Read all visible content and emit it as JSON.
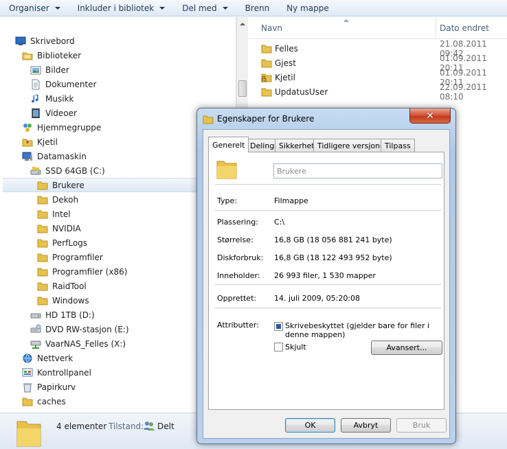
{
  "toolbar": {
    "organise": "Organiser",
    "include": "Inkluder i bibliotek",
    "share": "Del med",
    "burn": "Brenn",
    "new_folder": "Ny mappe"
  },
  "nav": {
    "items": [
      {
        "label": "Skrivebord"
      },
      {
        "label": "Biblioteker"
      },
      {
        "label": "Bilder"
      },
      {
        "label": "Dokumenter"
      },
      {
        "label": "Musikk"
      },
      {
        "label": "Videoer"
      },
      {
        "label": "Hjemmegruppe"
      },
      {
        "label": "Kjetil"
      },
      {
        "label": "Datamaskin"
      },
      {
        "label": "SSD 64GB (C:)"
      },
      {
        "label": "Brukere"
      },
      {
        "label": "Dekoh"
      },
      {
        "label": "Intel"
      },
      {
        "label": "NVIDIA"
      },
      {
        "label": "PerfLogs"
      },
      {
        "label": "Programfiler"
      },
      {
        "label": "Programfiler (x86)"
      },
      {
        "label": "RaidTool"
      },
      {
        "label": "Windows"
      },
      {
        "label": "HD 1TB (D:)"
      },
      {
        "label": "DVD RW-stasjon (E:)"
      },
      {
        "label": "VaarNAS_Felles (X:)"
      },
      {
        "label": "Nettverk"
      },
      {
        "label": "Kontrollpanel"
      },
      {
        "label": "Papirkurv"
      },
      {
        "label": "caches"
      }
    ]
  },
  "list": {
    "col_name": "Navn",
    "col_date": "Dato endret",
    "files": [
      {
        "name": "Felles",
        "date": "21.08.2011 09:42"
      },
      {
        "name": "Gjest",
        "date": "01.09.2011 20:11"
      },
      {
        "name": "Kjetil",
        "date": "01.09.2011 20:11"
      },
      {
        "name": "UpdatusUser",
        "date": "22.09.2011 08:10"
      }
    ]
  },
  "details": {
    "count": "4 elementer",
    "status_label": "Tilstand:",
    "status_value": "Delt"
  },
  "dialog": {
    "title": "Egenskaper for Brukere",
    "close": "✕",
    "tabs": [
      "Generelt",
      "Deling",
      "Sikkerhet",
      "Tidligere versjoner",
      "Tilpass"
    ],
    "name_value": "Brukere",
    "props": {
      "type_label": "Type:",
      "type_value": "Filmappe",
      "location_label": "Plassering:",
      "location_value": "C:\\",
      "size_label": "Størrelse:",
      "size_value": "16,8 GB (18 056 881 241 byte)",
      "disk_label": "Diskforbruk:",
      "disk_value": "16,8 GB (18 122 493 952 byte)",
      "contains_label": "Inneholder:",
      "contains_value": "26 993 filer, 1 530 mapper",
      "created_label": "Opprettet:",
      "created_value": "14. juli 2009, 05:20:08",
      "attributes_label": "Attributter:",
      "readonly_label": "Skrivebeskyttet (gjelder bare for filer i denne mappen)",
      "hidden_label": "Skjult",
      "advanced": "Avansert..."
    },
    "buttons": {
      "ok": "OK",
      "cancel": "Avbryt",
      "apply": "Bruk"
    }
  },
  "colors": {
    "folder": "#e8c24a",
    "selection": "#dde8f5",
    "close_red": "#c23a1c"
  }
}
